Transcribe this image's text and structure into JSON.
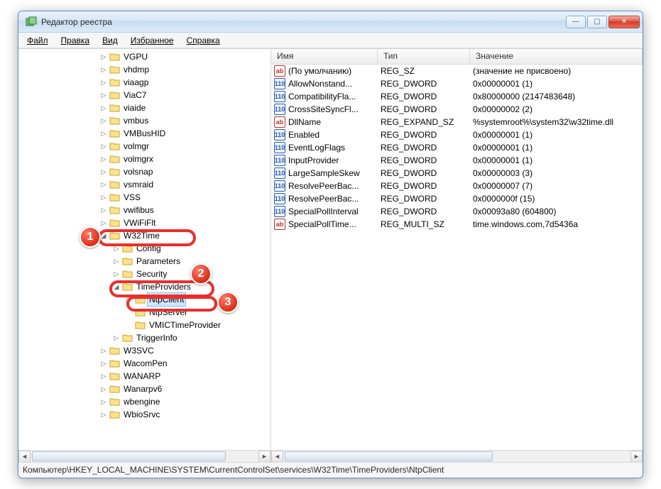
{
  "window": {
    "title": "Редактор реестра"
  },
  "menu": {
    "file": "Файл",
    "edit": "Правка",
    "view": "Вид",
    "fav": "Избранное",
    "help": "Справка"
  },
  "tree": {
    "items": [
      "VGPU",
      "vhdmp",
      "viaagp",
      "ViaC7",
      "viaide",
      "vmbus",
      "VMBusHID",
      "volmgr",
      "volmgrx",
      "volsnap",
      "vsmraid",
      "VSS",
      "vwifibus",
      "VWiFiFlt"
    ],
    "w32time": "W32Time",
    "w32children": {
      "config": "Config",
      "parameters": "Parameters",
      "security": "Security",
      "timeproviders": "TimeProviders",
      "ntpclient": "NtpClient",
      "ntpserver": "NtpServer",
      "vmic": "VMICTimeProvider",
      "trigger": "TriggerInfo"
    },
    "after": [
      "W3SVC",
      "WacomPen",
      "WANARP",
      "Wanarpv6",
      "wbengine",
      "WbioSrvc"
    ]
  },
  "list": {
    "cols": {
      "name": "Имя",
      "type": "Тип",
      "value": "Значение"
    },
    "rows": [
      {
        "icon": "sz",
        "name": "(По умолчанию)",
        "type": "REG_SZ",
        "value": "(значение не присвоено)"
      },
      {
        "icon": "dw",
        "name": "AllowNonstand...",
        "type": "REG_DWORD",
        "value": "0x00000001 (1)"
      },
      {
        "icon": "dw",
        "name": "CompatibilityFla...",
        "type": "REG_DWORD",
        "value": "0x80000000 (2147483648)"
      },
      {
        "icon": "dw",
        "name": "CrossSiteSyncFl...",
        "type": "REG_DWORD",
        "value": "0x00000002 (2)"
      },
      {
        "icon": "sz",
        "name": "DllName",
        "type": "REG_EXPAND_SZ",
        "value": "%systemroot%\\system32\\w32time.dll"
      },
      {
        "icon": "dw",
        "name": "Enabled",
        "type": "REG_DWORD",
        "value": "0x00000001 (1)"
      },
      {
        "icon": "dw",
        "name": "EventLogFlags",
        "type": "REG_DWORD",
        "value": "0x00000001 (1)"
      },
      {
        "icon": "dw",
        "name": "InputProvider",
        "type": "REG_DWORD",
        "value": "0x00000001 (1)"
      },
      {
        "icon": "dw",
        "name": "LargeSampleSkew",
        "type": "REG_DWORD",
        "value": "0x00000003 (3)"
      },
      {
        "icon": "dw",
        "name": "ResolvePeerBac...",
        "type": "REG_DWORD",
        "value": "0x00000007 (7)"
      },
      {
        "icon": "dw",
        "name": "ResolvePeerBac...",
        "type": "REG_DWORD",
        "value": "0x0000000f (15)"
      },
      {
        "icon": "dw",
        "name": "SpecialPollInterval",
        "type": "REG_DWORD",
        "value": "0x00093a80 (604800)"
      },
      {
        "icon": "sz",
        "name": "SpecialPollTime...",
        "type": "REG_MULTI_SZ",
        "value": "time.windows.com,7d5436a"
      }
    ]
  },
  "status": "Компьютер\\HKEY_LOCAL_MACHINE\\SYSTEM\\CurrentControlSet\\services\\W32Time\\TimeProviders\\NtpClient",
  "badges": {
    "b1": "1",
    "b2": "2",
    "b3": "3"
  }
}
